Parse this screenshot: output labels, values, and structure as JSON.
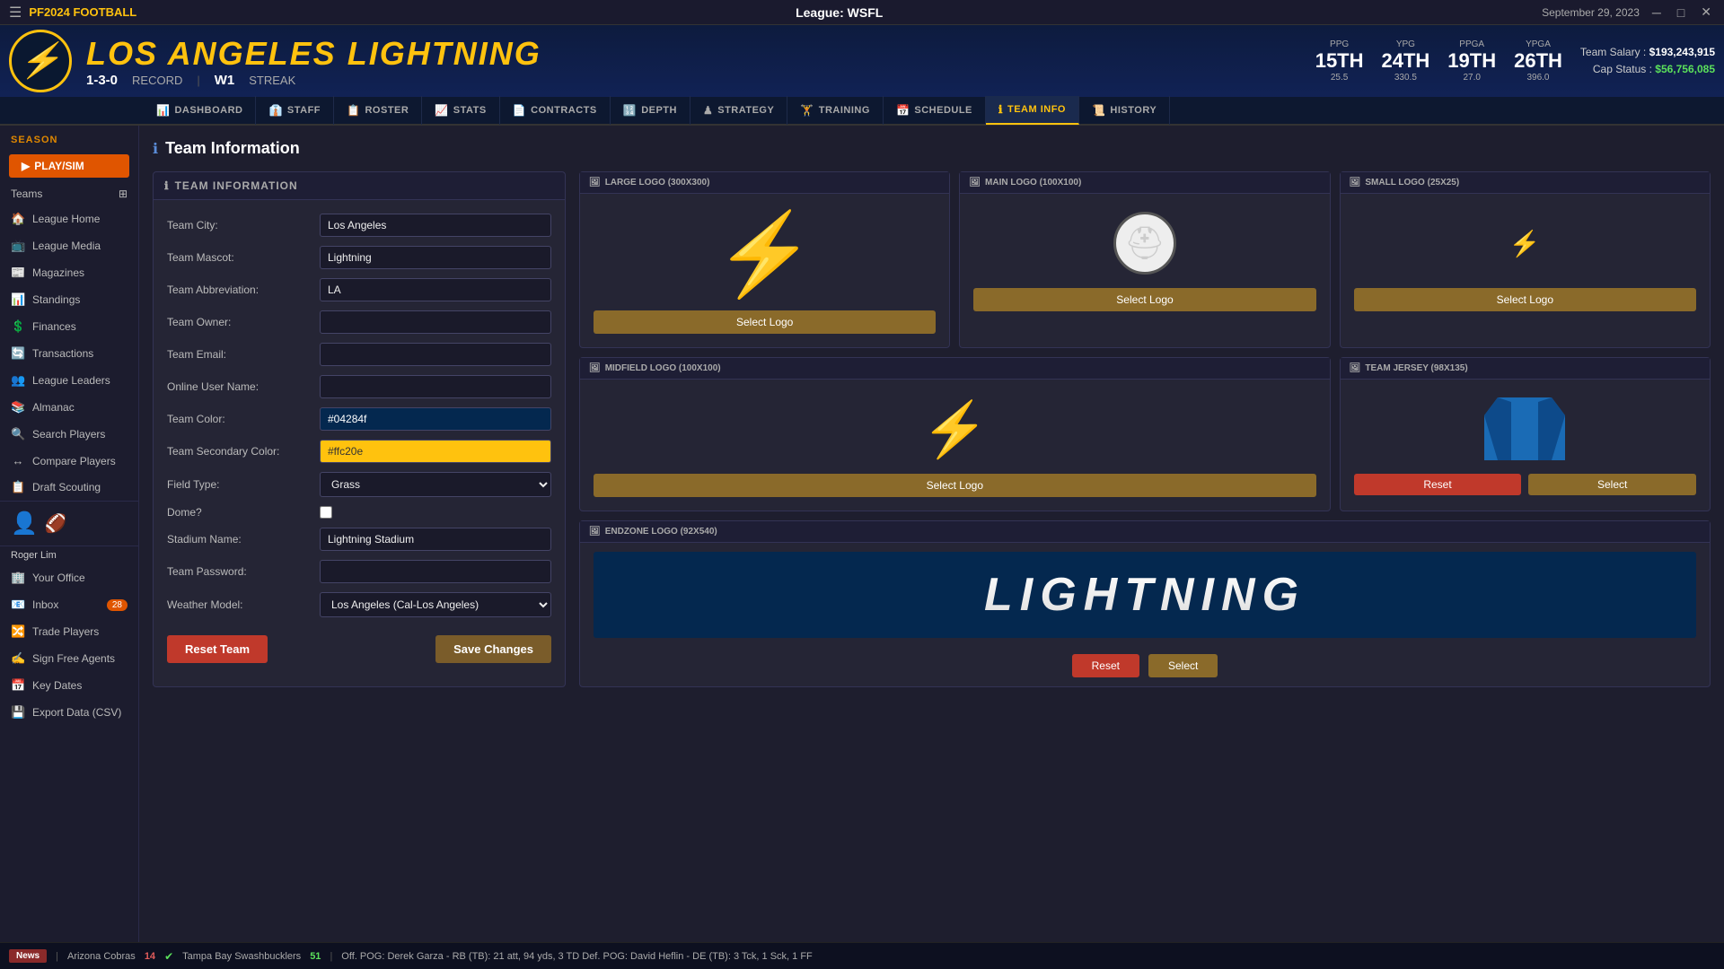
{
  "window": {
    "title": "League: WSFL",
    "date": "September 29, 2023"
  },
  "season": {
    "label": "SEASON",
    "play_sim": "PLAY/SIM"
  },
  "sidebar": {
    "teams_label": "Teams",
    "league_home": "League Home",
    "league_media": "League Media",
    "magazines": "Magazines",
    "standings": "Standings",
    "finances": "Finances",
    "transactions": "Transactions",
    "league_leaders": "League Leaders",
    "almanac": "Almanac",
    "search_players": "Search Players",
    "compare_players": "Compare Players",
    "draft_scouting": "Draft Scouting",
    "user_name": "Roger Lim",
    "your_office": "Your Office",
    "inbox": "Inbox",
    "inbox_count": "28",
    "trade_players": "Trade Players",
    "sign_free_agents": "Sign Free Agents",
    "key_dates": "Key Dates",
    "export_data": "Export Data (CSV)"
  },
  "team": {
    "city": "LOS ANGELES",
    "mascot": "LIGHTNING",
    "record": "1-3-0",
    "record_label": "RECORD",
    "streak": "W1",
    "streak_label": "STREAK",
    "ppg_label": "PPG",
    "ppg_rank": "15TH",
    "ppg_val": "25.5",
    "ypg_label": "YPG",
    "ypg_rank": "24TH",
    "ypg_val": "330.5",
    "ppga_label": "PPGA",
    "ppga_rank": "19TH",
    "ppga_val": "27.0",
    "ypga_label": "YPGA",
    "ypga_rank": "26TH",
    "ypga_val": "396.0",
    "salary_label": "Team Salary :",
    "salary_val": "$193,243,915",
    "cap_label": "Cap Status :",
    "cap_val": "$56,756,085"
  },
  "nav_tabs": [
    {
      "id": "dashboard",
      "label": "DASHBOARD",
      "icon": "📊"
    },
    {
      "id": "staff",
      "label": "STAFF",
      "icon": "👔"
    },
    {
      "id": "roster",
      "label": "ROSTER",
      "icon": "📋"
    },
    {
      "id": "stats",
      "label": "STATS",
      "icon": "📈"
    },
    {
      "id": "contracts",
      "label": "CONTRACTS",
      "icon": "📄"
    },
    {
      "id": "depth",
      "label": "DEPTH",
      "icon": "🔢"
    },
    {
      "id": "strategy",
      "label": "STRATEGY",
      "icon": "♟"
    },
    {
      "id": "training",
      "label": "TRAINING",
      "icon": "🏋"
    },
    {
      "id": "schedule",
      "label": "SCHEDULE",
      "icon": "📅"
    },
    {
      "id": "team_info",
      "label": "TEAM INFO",
      "icon": "ℹ"
    },
    {
      "id": "history",
      "label": "HISTORY",
      "icon": "📜"
    }
  ],
  "page": {
    "title": "Team Information"
  },
  "team_info_form": {
    "section_label": "TEAM INFORMATION",
    "city_label": "Team City:",
    "city_val": "Los Angeles",
    "mascot_label": "Team Mascot:",
    "mascot_val": "Lightning",
    "abbreviation_label": "Team Abbreviation:",
    "abbreviation_val": "LA",
    "owner_label": "Team Owner:",
    "owner_val": "",
    "email_label": "Team Email:",
    "email_val": "",
    "online_name_label": "Online User Name:",
    "online_name_val": "",
    "color_label": "Team Color:",
    "color_val": "#04284f",
    "secondary_color_label": "Team Secondary Color:",
    "secondary_color_val": "#ffc20e",
    "field_type_label": "Field Type:",
    "field_type_val": "Grass",
    "dome_label": "Dome?",
    "stadium_name_label": "Stadium Name:",
    "stadium_name_val": "Lightning Stadium",
    "password_label": "Team Password:",
    "password_val": "",
    "weather_model_label": "Weather Model:",
    "weather_model_val": "Los Angeles (Cal-Los Angeles)",
    "btn_reset": "Reset Team",
    "btn_save": "Save Changes"
  },
  "logos": {
    "large_label": "LARGE LOGO (300x300)",
    "main_label": "MAIN LOGO (100x100)",
    "small_label": "SMALL LOGO (25x25)",
    "midfield_label": "MIDFIELD LOGO (100x100)",
    "jersey_label": "TEAM JERSEY (98x135)",
    "endzone_label": "ENDZONE LOGO (92x540)",
    "select_logo": "Select Logo",
    "endzone_text": "LIGHTNING",
    "btn_reset": "Reset",
    "btn_select": "Select"
  },
  "statusbar": {
    "news_label": "News",
    "team1": "Arizona Cobras",
    "score1": "14",
    "team2": "Tampa Bay Swashbucklers",
    "score2": "51",
    "game_stats": "Off. POG: Derek Garza - RB (TB): 21 att, 94 yds, 3 TD    Def. POG: David Heflin - DE (TB): 3 Tck, 1 Sck, 1 FF"
  }
}
